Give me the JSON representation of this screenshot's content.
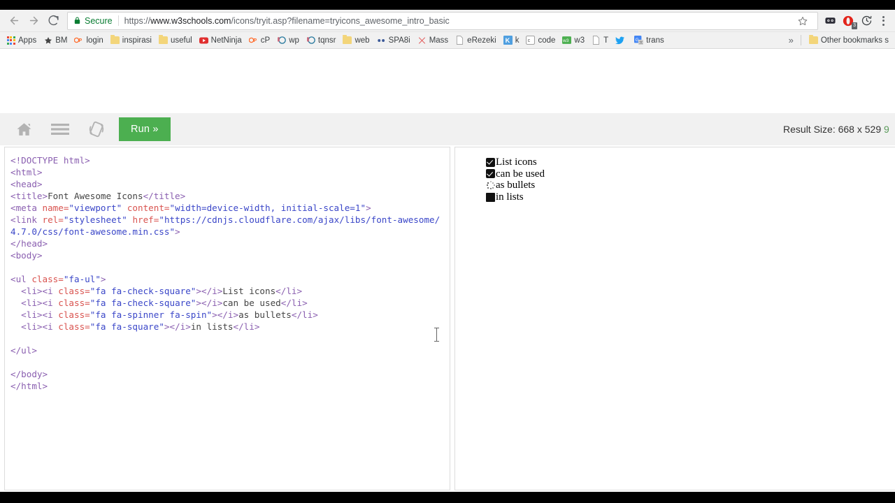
{
  "browser": {
    "nav": {
      "back_label": "Back",
      "forward_label": "Forward",
      "reload_label": "Reload"
    },
    "omnibox": {
      "security_label": "Secure",
      "url_scheme": "https://",
      "url_host": "www.w3schools.com",
      "url_path": "/icons/tryit.asp?filename=tryicons_awesome_intro_basic",
      "url_full": "https://www.w3schools.com/icons/tryit.asp?filename=tryicons_awesome_intro_basic",
      "bookmark_star": "☆"
    },
    "extensions": [
      {
        "name": "pocket-extension-icon",
        "badge": ""
      },
      {
        "name": "opera-extension-icon",
        "badge": "3"
      },
      {
        "name": "history-clock-extension-icon",
        "badge": ""
      }
    ],
    "menu_label": "Customize and control"
  },
  "bookmarks": {
    "apps_label": "Apps",
    "items": [
      {
        "label": "BM",
        "icon": "star-icon",
        "color": "#444444"
      },
      {
        "label": "login",
        "icon": "cpanel-icon",
        "color": "#ff6c2c"
      },
      {
        "label": "inspirasi",
        "icon": "folder-icon",
        "color": "#f3d57a"
      },
      {
        "label": "useful",
        "icon": "folder-icon",
        "color": "#f3d57a"
      },
      {
        "label": "NetNinja",
        "icon": "youtube-icon",
        "color": "#e02f2f"
      },
      {
        "label": "cP",
        "icon": "cpanel-icon",
        "color": "#ff6c2c"
      },
      {
        "label": "wp",
        "icon": "wordpress-icon",
        "color": "#21759b"
      },
      {
        "label": "tqnsr",
        "icon": "wordpress-icon",
        "color": "#21759b"
      },
      {
        "label": "web",
        "icon": "folder-icon",
        "color": "#f3d57a"
      },
      {
        "label": "SPA8i",
        "icon": "dots-icon",
        "color": "#3b5998"
      },
      {
        "label": "Mass",
        "icon": "scissors-icon",
        "color": "#e36464"
      },
      {
        "label": "eRezeki",
        "icon": "page-icon",
        "color": "#888888"
      },
      {
        "label": "k",
        "icon": "kaskus-icon",
        "color": "#2f7fd1"
      },
      {
        "label": "code",
        "icon": "codepen-icon",
        "color": "#555555"
      },
      {
        "label": "w3",
        "icon": "w3schools-icon",
        "color": "#4CAF50"
      },
      {
        "label": "T",
        "icon": "page-icon",
        "color": "#888888"
      },
      {
        "label": "",
        "icon": "twitter-icon",
        "color": "#1da1f2"
      },
      {
        "label": "trans",
        "icon": "google-translate-icon",
        "color": "#4285f4"
      }
    ],
    "overflow_label": "»",
    "other_bookmarks_label": "Other bookmarks s"
  },
  "tryit": {
    "toolbar": {
      "home_label": "Home",
      "menu_label": "Menu",
      "rotate_label": "Change Orientation",
      "run_label": "Run »"
    },
    "result_size": {
      "prefix": "Result Size:",
      "width": "668",
      "separator": "x",
      "height": "529",
      "cut_char": "9"
    },
    "editor": {
      "lines": [
        [
          {
            "t": "tag",
            "s": "<!DOCTYPE html>"
          }
        ],
        [
          {
            "t": "tag",
            "s": "<html>"
          }
        ],
        [
          {
            "t": "tag",
            "s": "<head>"
          }
        ],
        [
          {
            "t": "tag",
            "s": "<title>"
          },
          {
            "t": "txt",
            "s": "Font Awesome Icons"
          },
          {
            "t": "tag",
            "s": "</title>"
          }
        ],
        [
          {
            "t": "tag",
            "s": "<meta "
          },
          {
            "t": "attr",
            "s": "name="
          },
          {
            "t": "val",
            "s": "\"viewport\""
          },
          {
            "t": "txt",
            "s": " "
          },
          {
            "t": "attr",
            "s": "content="
          },
          {
            "t": "val",
            "s": "\"width=device-width, initial-scale=1\""
          },
          {
            "t": "tag",
            "s": ">"
          }
        ],
        [
          {
            "t": "tag",
            "s": "<link "
          },
          {
            "t": "attr",
            "s": "rel="
          },
          {
            "t": "val",
            "s": "\"stylesheet\""
          },
          {
            "t": "txt",
            "s": " "
          },
          {
            "t": "attr",
            "s": "href="
          },
          {
            "t": "val",
            "s": "\"https://cdnjs.cloudflare.com/ajax/libs/font-awesome/4.7.0/css/font-awesome.min.css\""
          },
          {
            "t": "tag",
            "s": ">"
          }
        ],
        [
          {
            "t": "tag",
            "s": "</head>"
          }
        ],
        [
          {
            "t": "tag",
            "s": "<body>"
          }
        ],
        [
          {
            "t": "txt",
            "s": ""
          }
        ],
        [
          {
            "t": "tag",
            "s": "<ul "
          },
          {
            "t": "attr",
            "s": "class="
          },
          {
            "t": "val",
            "s": "\"fa-ul\""
          },
          {
            "t": "tag",
            "s": ">"
          }
        ],
        [
          {
            "t": "txt",
            "s": "  "
          },
          {
            "t": "tag",
            "s": "<li><i "
          },
          {
            "t": "attr",
            "s": "class="
          },
          {
            "t": "val",
            "s": "\"fa fa-check-square\""
          },
          {
            "t": "tag",
            "s": "></i>"
          },
          {
            "t": "txt",
            "s": "List icons"
          },
          {
            "t": "tag",
            "s": "</li>"
          }
        ],
        [
          {
            "t": "txt",
            "s": "  "
          },
          {
            "t": "tag",
            "s": "<li><i "
          },
          {
            "t": "attr",
            "s": "class="
          },
          {
            "t": "val",
            "s": "\"fa fa-check-square\""
          },
          {
            "t": "tag",
            "s": "></i>"
          },
          {
            "t": "txt",
            "s": "can be used"
          },
          {
            "t": "tag",
            "s": "</li>"
          }
        ],
        [
          {
            "t": "txt",
            "s": "  "
          },
          {
            "t": "tag",
            "s": "<li><i "
          },
          {
            "t": "attr",
            "s": "class="
          },
          {
            "t": "val",
            "s": "\"fa fa-spinner fa-spin\""
          },
          {
            "t": "tag",
            "s": "></i>"
          },
          {
            "t": "txt",
            "s": "as bullets"
          },
          {
            "t": "tag",
            "s": "</li>"
          }
        ],
        [
          {
            "t": "txt",
            "s": "  "
          },
          {
            "t": "tag",
            "s": "<li><i "
          },
          {
            "t": "attr",
            "s": "class="
          },
          {
            "t": "val",
            "s": "\"fa fa-square\""
          },
          {
            "t": "tag",
            "s": "></i>"
          },
          {
            "t": "txt",
            "s": "in lists"
          },
          {
            "t": "tag",
            "s": "</li>"
          }
        ],
        [
          {
            "t": "txt",
            "s": ""
          }
        ],
        [
          {
            "t": "tag",
            "s": "</ul>"
          }
        ],
        [
          {
            "t": "txt",
            "s": ""
          }
        ],
        [
          {
            "t": "tag",
            "s": "</body>"
          }
        ],
        [
          {
            "t": "tag",
            "s": "</html>"
          }
        ]
      ]
    },
    "result": {
      "items": [
        {
          "icon": "check-square-icon",
          "label": "List icons"
        },
        {
          "icon": "check-square-icon",
          "label": "can be used"
        },
        {
          "icon": "spinner-icon",
          "label": "as bullets"
        },
        {
          "icon": "square-icon",
          "label": "in lists"
        }
      ]
    }
  },
  "colors": {
    "run_green": "#4CAF50",
    "secure_green": "#0a7d33",
    "toolbar_gray": "#f1f1f1",
    "code_tag": "#8a5fb0",
    "code_attr": "#d9534f",
    "code_value": "#3a46c8"
  }
}
